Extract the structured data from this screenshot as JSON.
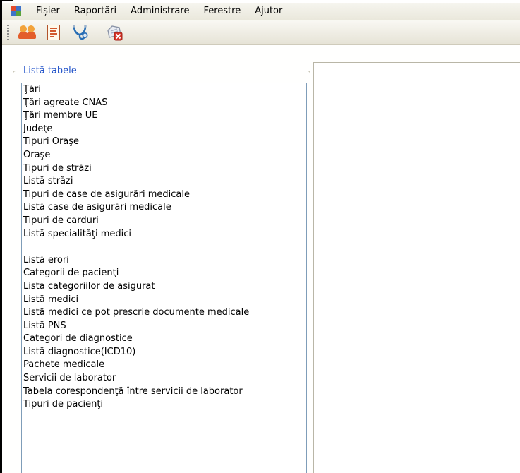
{
  "menubar": {
    "items": [
      "Fișier",
      "Raportări",
      "Administrare",
      "Ferestre",
      "Ajutor"
    ]
  },
  "toolbar": {
    "buttons": [
      "users-icon",
      "report-icon",
      "stethoscope-icon",
      "delete-icon"
    ]
  },
  "table_list": {
    "title": "Listă tabele",
    "items": [
      "Ţări",
      "Ţări agreate CNAS",
      "Ţări membre UE",
      "Judeţe",
      "Tipuri Oraşe",
      "Oraşe",
      "Tipuri de străzi",
      "Listă străzi",
      "Tipuri de case de asigurări medicale",
      "Listă case de asigurări medicale",
      "Tipuri de carduri",
      "Listă specialităţi medici",
      "",
      "Listă erori",
      "Categorii de pacienţi",
      "Lista categoriilor de asigurat",
      "Listă medici",
      "Listă medici ce pot prescrie documente medicale",
      "Listă PNS",
      "Categori de diagnostice",
      "Listă diagnostice(ICD10)",
      "Pachete medicale",
      "Servicii de laborator",
      "Tabela corespondenţă între servicii de laborator",
      "Tipuri de pacienţi"
    ]
  }
}
